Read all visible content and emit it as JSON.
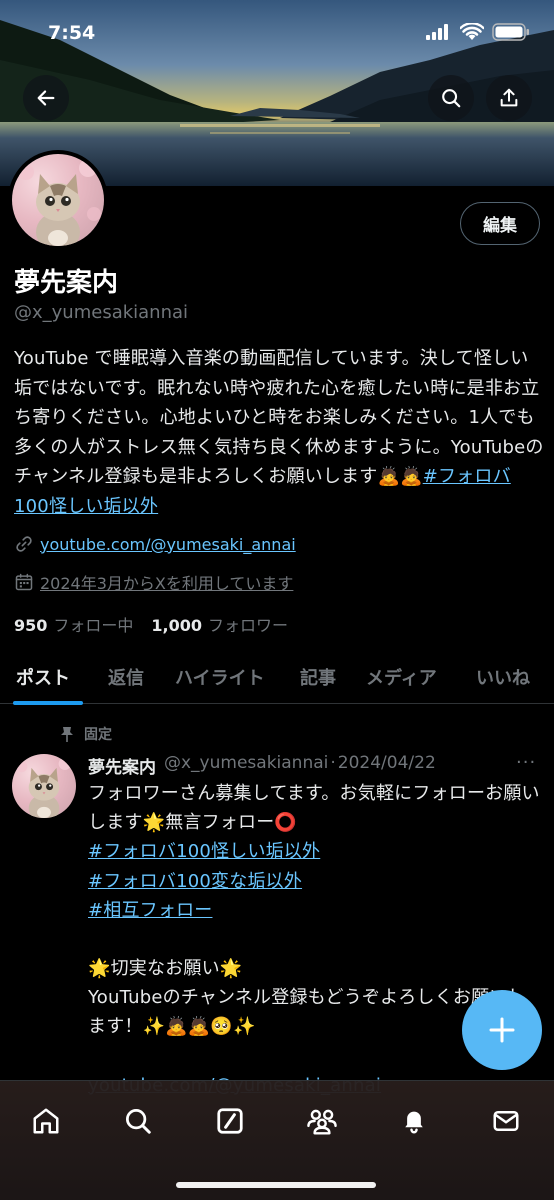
{
  "status": {
    "time": "7:54"
  },
  "profile": {
    "display_name": "夢先案内",
    "handle": "@x_yumesakiannai",
    "edit_label": "編集",
    "bio_text": "YouTube で睡眠導入音楽の動画配信しています。決して怪しい垢ではないです。眠れない時や疲れた心を癒したい時に是非お立ち寄りください。心地よいひと時をお楽しみください。1人でも多くの人がストレス無く気持ち良く休めますように。YouTubeのチャンネル登録も是非よろしくお願いします",
    "bio_emoji": "🙇🙇",
    "bio_hashtag": "#フォロバ100怪しい垢以外",
    "website": "youtube.com/@yumesaki_annai",
    "joined": "2024年3月からXを利用しています",
    "following_count": "950",
    "following_label": "フォロー中",
    "followers_count": "1,000",
    "followers_label": "フォロワー"
  },
  "tabs": [
    {
      "label": "ポスト",
      "active": true
    },
    {
      "label": "返信",
      "active": false
    },
    {
      "label": "ハイライト",
      "active": false
    },
    {
      "label": "記事",
      "active": false
    },
    {
      "label": "メディア",
      "active": false
    },
    {
      "label": "いいね",
      "active": false
    }
  ],
  "post": {
    "pinned_label": "固定",
    "author_name": "夢先案内",
    "author_handle": "@x_yumesakiannai",
    "separator": "·",
    "date": "2024/04/22",
    "more": "···",
    "line1": "フォロワーさん募集してます。お気軽にフォローお願いします🌟無言フォロー⭕",
    "tag1": "#フォロバ100怪しい垢以外",
    "tag2": "#フォロバ100変な垢以外",
    "tag3": "#相互フォロー",
    "line2": "🌟切実なお願い🌟",
    "line3": "YouTubeのチャンネル登録もどうぞよろしくお願いします！✨🙇🙇🥺✨",
    "link": "youtube.com/@yumesaki_annai"
  },
  "colors": {
    "accent": "#1d9bf0",
    "link": "#6ac6ff",
    "fab": "#57b8f5",
    "muted": "#71767b"
  },
  "icons": {
    "back": "arrow-left-icon",
    "search": "search-icon",
    "share": "share-icon",
    "link": "link-icon",
    "calendar": "calendar-icon",
    "pin": "pin-icon",
    "compose": "plus-icon",
    "nav": [
      "home-icon",
      "search-icon",
      "grok-icon",
      "communities-icon",
      "bell-icon",
      "mail-icon"
    ]
  }
}
